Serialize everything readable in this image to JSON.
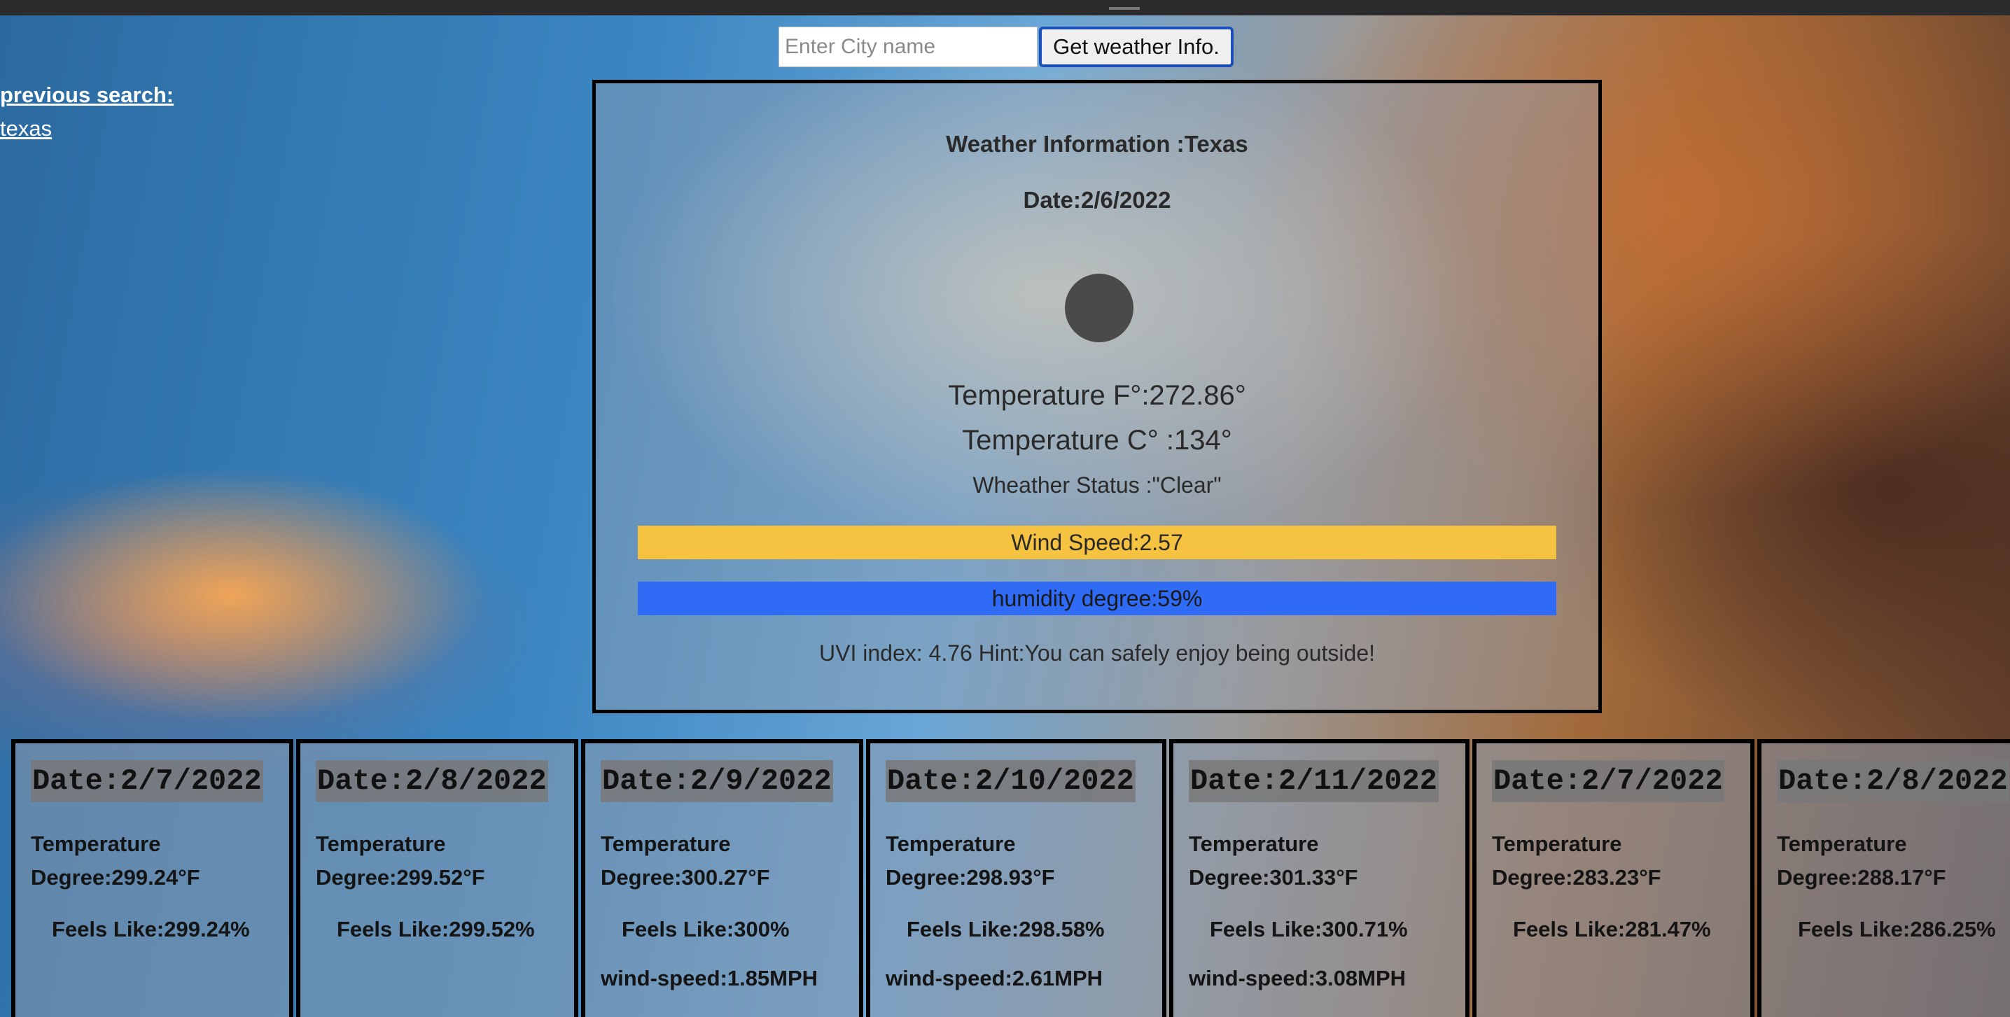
{
  "search": {
    "placeholder": "Enter City name",
    "value": "",
    "button_label": "Get weather Info."
  },
  "history": {
    "title": "previous search:",
    "items": [
      "texas"
    ]
  },
  "current": {
    "title": "Weather Information :Texas",
    "date": "Date:2/6/2022",
    "icon": "weather-status-icon",
    "temp_f": "Temperature F°:272.86°",
    "temp_c": "Temperature C° :134°",
    "status": "Wheather Status :\"Clear\"",
    "wind": "Wind Speed:2.57",
    "humidity": "humidity degree:59%",
    "uvi": "UVI index: 4.76 Hint:You can safely enjoy being outside!",
    "colors": {
      "wind_bar": "#f5c242",
      "humidity_bar": "#2f6bf5"
    }
  },
  "forecast": [
    {
      "date": "Date:2/7/2022",
      "temp": "Temperature Degree:299.24°F",
      "feels": "Feels Like:299.24%",
      "wind": ""
    },
    {
      "date": "Date:2/8/2022",
      "temp": "Temperature Degree:299.52°F",
      "feels": "Feels Like:299.52%",
      "wind": ""
    },
    {
      "date": "Date:2/9/2022",
      "temp": "Temperature Degree:300.27°F",
      "feels": "Feels Like:300%",
      "wind": "wind-speed:1.85MPH"
    },
    {
      "date": "Date:2/10/2022",
      "temp": "Temperature Degree:298.93°F",
      "feels": "Feels Like:298.58%",
      "wind": "wind-speed:2.61MPH"
    },
    {
      "date": "Date:2/11/2022",
      "temp": "Temperature Degree:301.33°F",
      "feels": "Feels Like:300.71%",
      "wind": "wind-speed:3.08MPH"
    },
    {
      "date": "Date:2/7/2022",
      "temp": "Temperature Degree:283.23°F",
      "feels": "Feels Like:281.47%",
      "wind": ""
    },
    {
      "date": "Date:2/8/2022",
      "temp": "Temperature Degree:288.17°F",
      "feels": "Feels Like:286.25%",
      "wind": ""
    }
  ]
}
